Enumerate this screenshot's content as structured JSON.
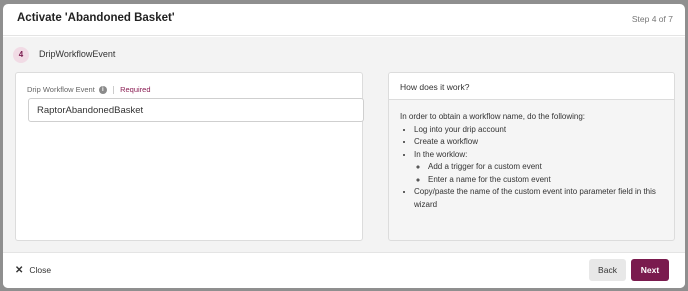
{
  "modal": {
    "title": "Activate 'Abandoned Basket'",
    "step_indicator": "Step 4 of 7"
  },
  "step": {
    "number": "4",
    "name": "DripWorkflowEvent"
  },
  "form": {
    "field_label": "Drip Workflow Event",
    "required_label": "Required",
    "field_value": "RaptorAbandonedBasket"
  },
  "help": {
    "title": "How does it work?",
    "intro": "In order to obtain a workflow name, do the following:",
    "items": [
      "Log into your drip account",
      "Create a workflow",
      "In the worklow:",
      "Copy/paste the name of the custom event into parameter field in this wizard"
    ],
    "subitems": [
      "Add a trigger for a custom event",
      "Enter a name for the custom event"
    ]
  },
  "footer": {
    "close_label": "Close",
    "back_label": "Back",
    "next_label": "Next"
  },
  "colors": {
    "accent": "#7a1b4e",
    "step_badge_bg": "#f1dbe5"
  },
  "icons": {
    "info": "info-icon",
    "close": "close-icon"
  }
}
